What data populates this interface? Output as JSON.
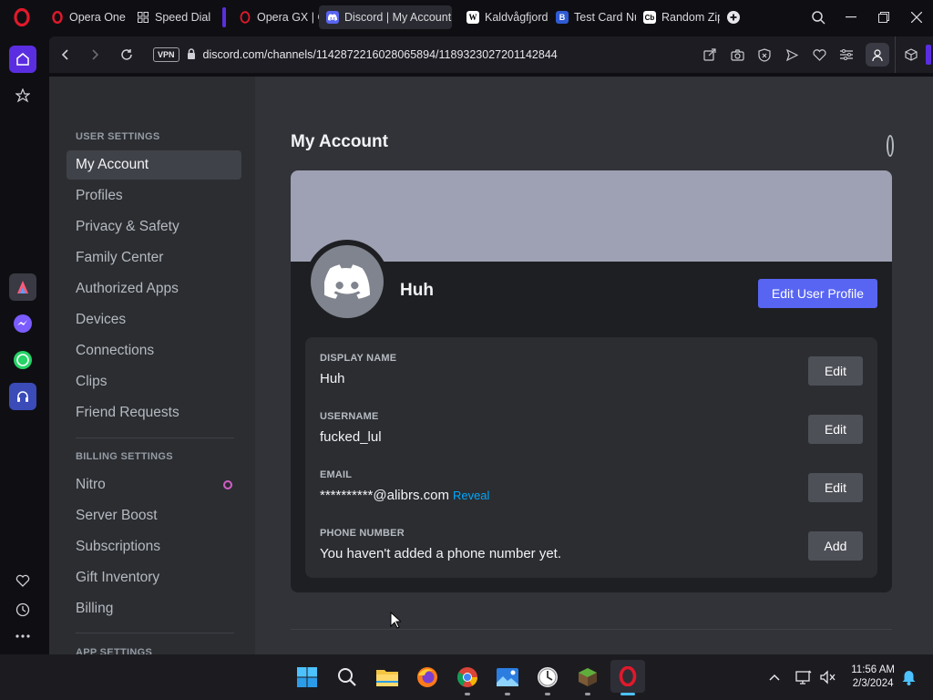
{
  "browser": {
    "tabs": [
      {
        "label": "Opera One",
        "favicon": "opera-icon"
      },
      {
        "label": "Speed Dial",
        "favicon": "grid-icon"
      },
      {
        "label": "Opera GX | G",
        "favicon": "opera-gx-icon"
      },
      {
        "label": "Discord | My Account",
        "favicon": "discord-icon",
        "active": true
      },
      {
        "label": "Kaldvågfjord",
        "favicon": "wikipedia-icon"
      },
      {
        "label": "Test Card Nu",
        "favicon": "b-icon"
      },
      {
        "label": "Random Zip",
        "favicon": "cb-icon"
      }
    ],
    "favicon_letters": {
      "wikipedia": "W",
      "b": "B",
      "cb": "Cb"
    },
    "vpn_label": "VPN",
    "url": "discord.com/channels/1142872216028065894/1189323027201142844"
  },
  "settings_nav": {
    "user_settings_header": "USER SETTINGS",
    "user_items": [
      "My Account",
      "Profiles",
      "Privacy & Safety",
      "Family Center",
      "Authorized Apps",
      "Devices",
      "Connections",
      "Clips",
      "Friend Requests"
    ],
    "billing_settings_header": "BILLING SETTINGS",
    "billing_items": [
      "Nitro",
      "Server Boost",
      "Subscriptions",
      "Gift Inventory",
      "Billing"
    ],
    "app_settings_header": "APP SETTINGS"
  },
  "account": {
    "title": "My Account",
    "profile_name": "Huh",
    "edit_profile_label": "Edit User Profile",
    "fields": [
      {
        "label": "DISPLAY NAME",
        "value": "Huh",
        "button": "Edit"
      },
      {
        "label": "USERNAME",
        "value": "fucked_lul",
        "button": "Edit"
      },
      {
        "label": "EMAIL",
        "value": "**********@alibrs.com",
        "link": "Reveal",
        "button": "Edit"
      },
      {
        "label": "PHONE NUMBER",
        "value": "You haven't added a phone number yet.",
        "button": "Add"
      }
    ]
  },
  "taskbar": {
    "time": "11:56 AM",
    "date": "2/3/2024"
  },
  "colors": {
    "discord_blurple": "#5865f2",
    "banner": "#9ea1b3",
    "link": "#00a8fc",
    "opera_red": "#e0192b"
  }
}
